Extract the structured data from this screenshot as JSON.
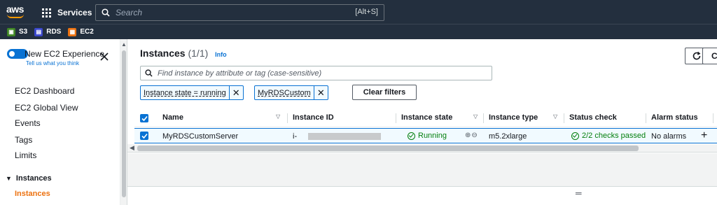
{
  "topnav": {
    "logo_text": "aws",
    "services_label": "Services",
    "search_placeholder": "Search",
    "search_shortcut": "[Alt+S]"
  },
  "favorites": [
    {
      "label": "S3",
      "color": "#3f8624"
    },
    {
      "label": "RDS",
      "color": "#3b48cc"
    },
    {
      "label": "EC2",
      "color": "#ec7211"
    }
  ],
  "sidebar": {
    "experience_title": "New EC2 Experience",
    "experience_sub": "Tell us what you think",
    "items": [
      "EC2 Dashboard",
      "EC2 Global View",
      "Events",
      "Tags",
      "Limits"
    ],
    "group_label": "Instances",
    "active_item": "Instances"
  },
  "panel": {
    "title": "Instances",
    "count": "(1/1)",
    "info": "Info",
    "cut_button": "Co",
    "search_placeholder": "Find instance by attribute or tag (case-sensitive)",
    "tokens": [
      "Instance state = running",
      "MyRDSCustom"
    ],
    "clear_filters": "Clear filters"
  },
  "table": {
    "columns": [
      "Name",
      "Instance ID",
      "Instance state",
      "Instance type",
      "Status check",
      "Alarm status"
    ],
    "rows": [
      {
        "name": "MyRDSCustomServer",
        "instance_id_prefix": "i-",
        "state": "Running",
        "type": "m5.2xlarge",
        "status_check": "2/2 checks passed",
        "alarm": "No alarms"
      }
    ]
  },
  "colors": {
    "nav_bg": "#232f3e",
    "accent": "#0972d3",
    "active_orange": "#ec7211",
    "success": "#037f0c"
  }
}
